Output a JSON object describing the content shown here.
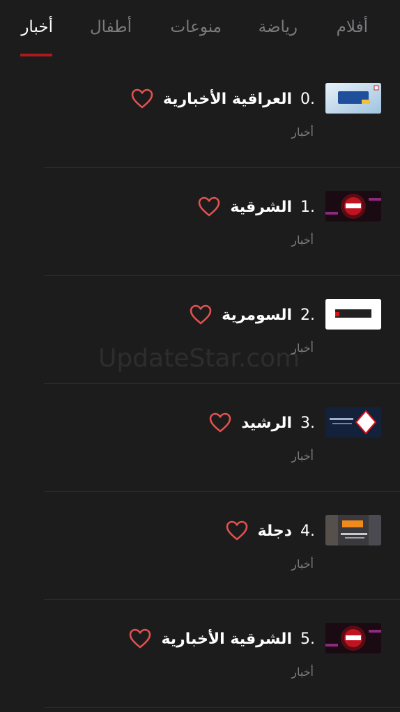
{
  "tabs": [
    {
      "label": "أفلام",
      "active": false
    },
    {
      "label": "رياضة",
      "active": false
    },
    {
      "label": "منوعات",
      "active": false
    },
    {
      "label": "أطفال",
      "active": false
    },
    {
      "label": "أخبار",
      "active": true
    }
  ],
  "channels": [
    {
      "number": "0.",
      "name": "العراقية الأخبارية",
      "category": "أخبار",
      "thumb_style": "alIraqiya"
    },
    {
      "number": "1.",
      "name": "الشرقية",
      "category": "أخبار",
      "thumb_style": "alSharqiya"
    },
    {
      "number": "2.",
      "name": "السومرية",
      "category": "أخبار",
      "thumb_style": "alSumaria"
    },
    {
      "number": "3.",
      "name": "الرشيد",
      "category": "أخبار",
      "thumb_style": "alRasheed"
    },
    {
      "number": "4.",
      "name": "دجلة",
      "category": "أخبار",
      "thumb_style": "dijlah"
    },
    {
      "number": "5.",
      "name": "الشرقية الأخبارية",
      "category": "أخبار",
      "thumb_style": "alSharqiya"
    }
  ],
  "watermark": "UpdateStar.com",
  "colors": {
    "background": "#1c1c1d",
    "accent": "#b0191c",
    "heart": "#e0524f",
    "muted_text": "#7f7f82",
    "tab_inactive": "#7b7b7e"
  },
  "icons": {
    "favorite": "heart-outline-icon"
  }
}
